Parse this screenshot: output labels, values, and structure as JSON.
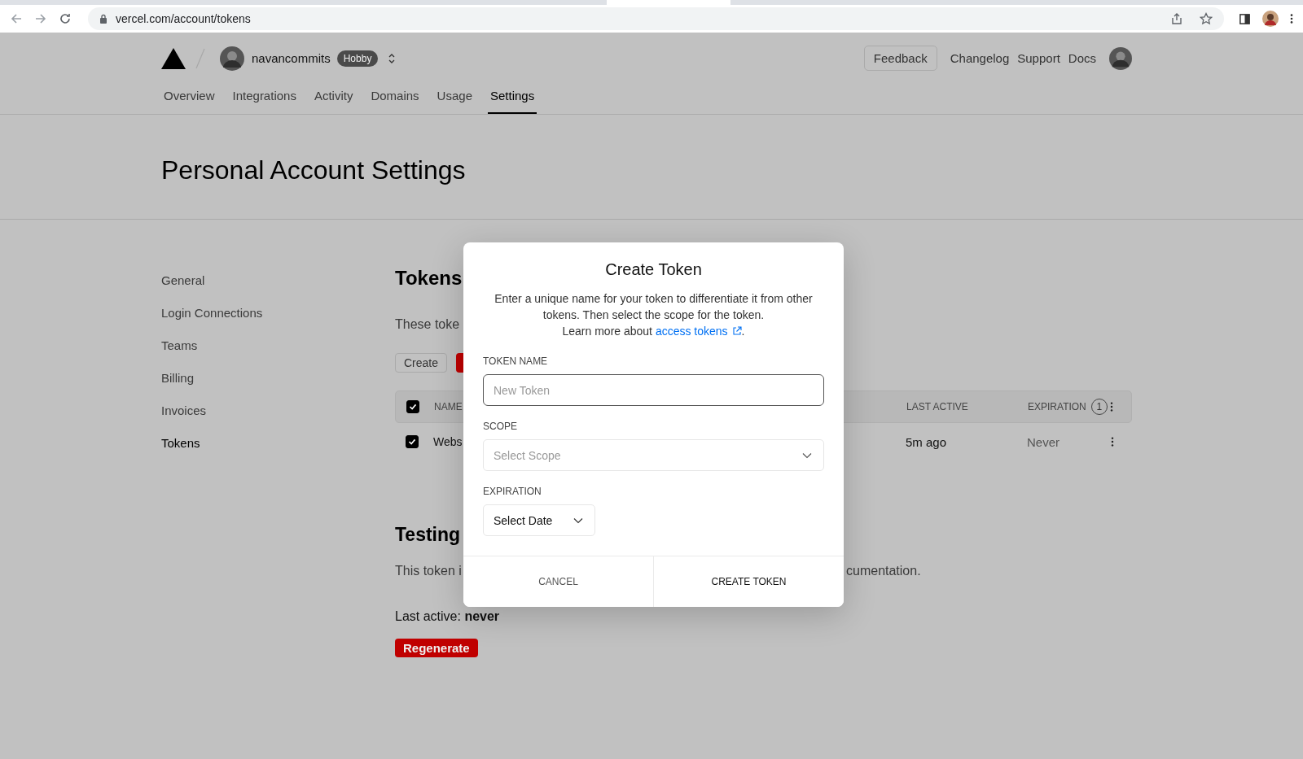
{
  "browser": {
    "url": "vercel.com/account/tokens"
  },
  "header": {
    "user": "navancommits",
    "plan": "Hobby",
    "feedback": "Feedback",
    "links": [
      {
        "label": "Changelog"
      },
      {
        "label": "Support"
      },
      {
        "label": "Docs"
      }
    ]
  },
  "nav": [
    {
      "label": "Overview",
      "selected": false
    },
    {
      "label": "Integrations",
      "selected": false
    },
    {
      "label": "Activity",
      "selected": false
    },
    {
      "label": "Domains",
      "selected": false
    },
    {
      "label": "Usage",
      "selected": false
    },
    {
      "label": "Settings",
      "selected": true
    }
  ],
  "page_title": "Personal Account Settings",
  "sidebar": [
    {
      "label": "General",
      "selected": false
    },
    {
      "label": "Login Connections",
      "selected": false
    },
    {
      "label": "Teams",
      "selected": false
    },
    {
      "label": "Billing",
      "selected": false
    },
    {
      "label": "Invoices",
      "selected": false
    },
    {
      "label": "Tokens",
      "selected": true
    }
  ],
  "tokens": {
    "title": "Tokens",
    "description": "These toke",
    "create_button": "Create",
    "table": {
      "all_checked": true,
      "columns": [
        {
          "label": "NAME"
        },
        {
          "label": "LAST ACTIVE"
        },
        {
          "label": "EXPIRATION",
          "count": "1"
        }
      ],
      "rows": [
        {
          "checked": true,
          "name": "Webs",
          "last_active": "5m ago",
          "expiration": "Never"
        }
      ]
    }
  },
  "testing": {
    "title": "Testing",
    "description_start": "This token i",
    "description_end": "cumentation.",
    "last_active": "Last active: **never**",
    "regenerate": "Regenerate"
  },
  "modal": {
    "title": "Create Token",
    "description": "Enter a unique name for your token to differentiate it from other tokens. Then select the scope for the token.",
    "learn_more": "Learn more about",
    "link": "access tokens",
    "link_end": ".",
    "name_label": "TOKEN NAME",
    "name_placeholder": "New Token",
    "scope_label": "SCOPE",
    "scope_placeholder": "Select Scope",
    "expiration_label": "EXPIRATION",
    "expiration_value": "Select Date",
    "buttons": [
      {
        "label": "CANCEL",
        "kind": "secondary"
      },
      {
        "label": "CREATE TOKEN",
        "kind": "primary"
      }
    ]
  }
}
